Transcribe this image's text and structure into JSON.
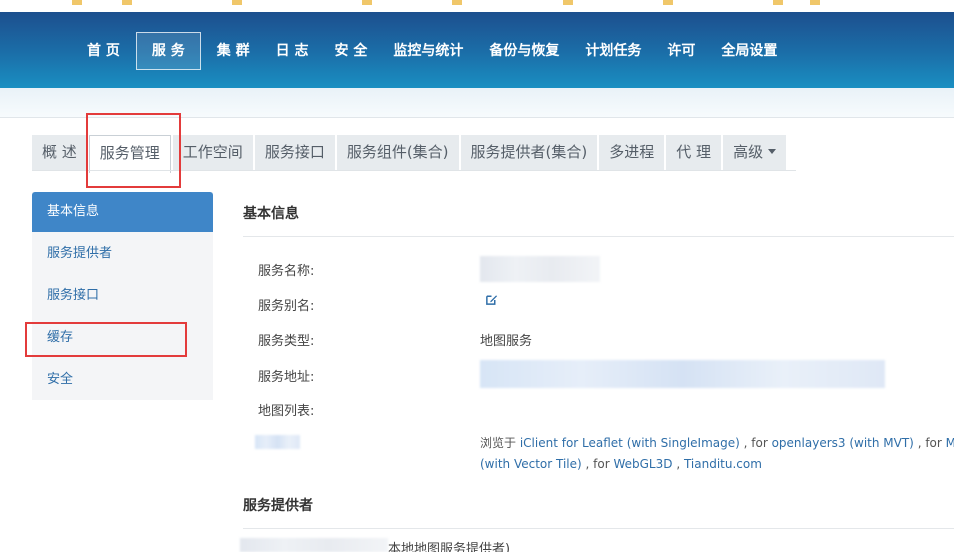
{
  "header": {
    "nav": [
      "首 页",
      "服 务",
      "集 群",
      "日 志",
      "安 全",
      "监控与统计",
      "备份与恢复",
      "计划任务",
      "许可",
      "全局设置"
    ],
    "active_nav": "服 务"
  },
  "tabs": {
    "items": [
      "概 述",
      "服务管理",
      "工作空间",
      "服务接口",
      "服务组件(集合)",
      "服务提供者(集合)",
      "多进程",
      "代 理",
      "高级"
    ],
    "active": "服务管理"
  },
  "side_menu": {
    "items": [
      "基本信息",
      "服务提供者",
      "服务接口",
      "缓存",
      "安全"
    ],
    "active": "基本信息"
  },
  "basic_info": {
    "title": "基本信息",
    "labels": {
      "service_name": "服务名称:",
      "service_alias": "服务别名:",
      "service_type": "服务类型:",
      "service_address": "服务地址:",
      "map_list": "地图列表:"
    },
    "service_type_value": "地图服务",
    "browse_prefix": "浏览于 ",
    "browse_links": {
      "leaflet": "iClient for Leaflet (with SingleImage)",
      "sep1": " , for ",
      "openlayers": "openlayers3 (with MVT)",
      "sep2": " , for ",
      "mapbox": "Mapb",
      "vector_tile": "(with Vector Tile)",
      "sep3": " , for ",
      "webgl": "WebGL3D",
      "sep4": " , ",
      "tianditu": "Tianditu.com"
    }
  },
  "provider": {
    "title": "服务提供者",
    "row_tail": "本地地图服务提供者)"
  },
  "colors": {
    "header_top": "#1c4f8e",
    "header_bottom": "#1a8fc2",
    "accent": "#3f86c8",
    "link": "#2f6ea8",
    "annotation": "#e33b3b"
  }
}
